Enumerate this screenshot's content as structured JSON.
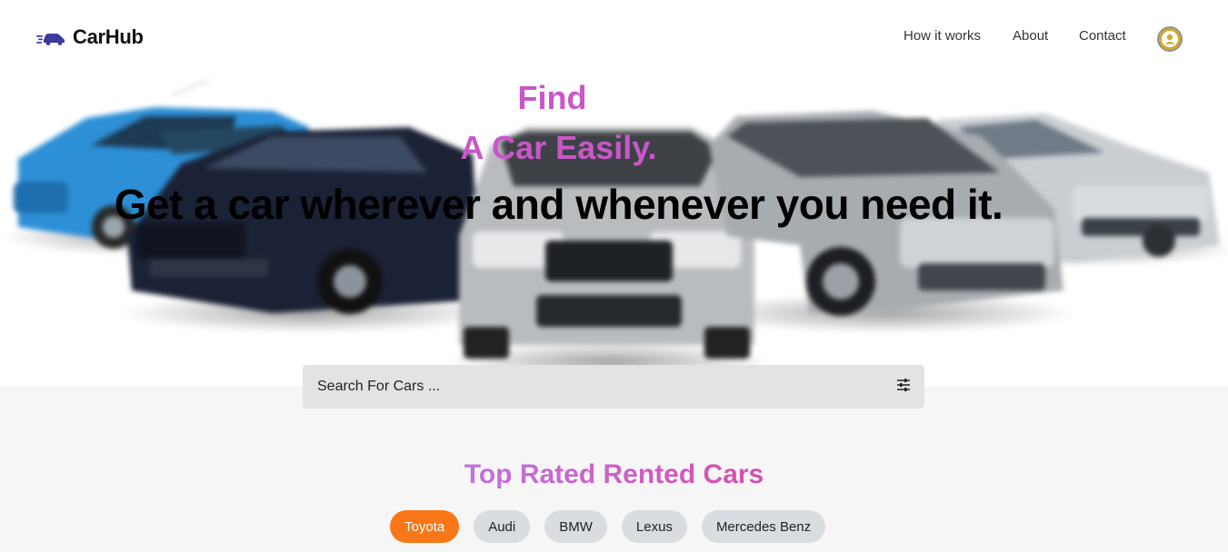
{
  "colors": {
    "accent": "#c957c8",
    "brand_icon": "#3d3a9c",
    "active_chip": "#f97716",
    "chip": "#d9dce0",
    "search_bg": "#e3e3e3"
  },
  "header": {
    "brand": "CarHub",
    "brand_icon": "car-speed-icon",
    "nav": [
      {
        "label": "How it works"
      },
      {
        "label": "About"
      },
      {
        "label": "Contact"
      }
    ],
    "avatar_icon": "user-avatar-icon"
  },
  "hero": {
    "headline_line1": "Find",
    "headline_line2": "A Car Easily.",
    "tagline": "Get a car wherever and whenever you need it.",
    "image_icon": "car-lineup-image"
  },
  "search": {
    "placeholder": "Search For Cars ...",
    "value": "",
    "filter_icon": "sliders-icon"
  },
  "top_rated": {
    "title": "Top Rated Rented Cars",
    "brands": [
      "Toyota",
      "Audi",
      "BMW",
      "Lexus",
      "Mercedes Benz"
    ],
    "selected": "Toyota"
  }
}
